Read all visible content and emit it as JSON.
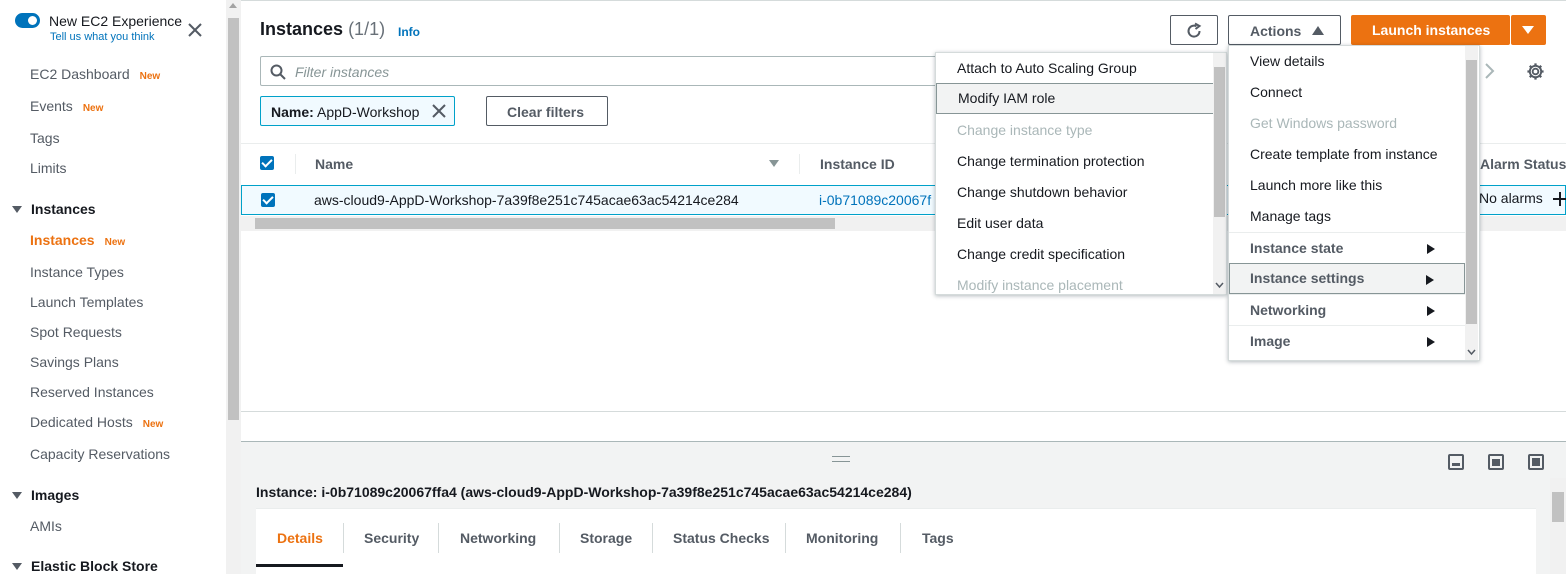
{
  "sidebar": {
    "experience_title": "New EC2 Experience",
    "experience_subtitle": "Tell us what you think",
    "items": [
      {
        "label": "EC2 Dashboard",
        "badge": "New"
      },
      {
        "label": "Events",
        "badge": "New"
      },
      {
        "label": "Tags"
      },
      {
        "label": "Limits"
      }
    ],
    "section_instances": "Instances",
    "instances_items": [
      {
        "label": "Instances",
        "badge": "New",
        "active": true
      },
      {
        "label": "Instance Types"
      },
      {
        "label": "Launch Templates"
      },
      {
        "label": "Spot Requests"
      },
      {
        "label": "Savings Plans"
      },
      {
        "label": "Reserved Instances"
      },
      {
        "label": "Dedicated Hosts",
        "badge": "New"
      },
      {
        "label": "Capacity Reservations"
      }
    ],
    "section_images": "Images",
    "images_items": [
      {
        "label": "AMIs"
      }
    ],
    "section_ebs": "Elastic Block Store"
  },
  "header": {
    "title": "Instances",
    "count": "(1/1)",
    "info": "Info",
    "actions_label": "Actions",
    "launch_label": "Launch instances"
  },
  "filter": {
    "placeholder": "Filter instances",
    "token_key": "Name:",
    "token_value": "AppD-Workshop",
    "clear_label": "Clear filters"
  },
  "table": {
    "columns": [
      "Name",
      "Instance ID",
      "Alarm Status"
    ],
    "rows": [
      {
        "name": "aws-cloud9-AppD-Workshop-7a39f8e251c745acae63ac54214ce284",
        "instance_id": "i-0b71089c20067f",
        "alarm_status": "No alarms"
      }
    ]
  },
  "actions_menu": {
    "items": [
      {
        "label": "View details"
      },
      {
        "label": "Connect"
      },
      {
        "label": "Get Windows password",
        "disabled": true
      },
      {
        "label": "Create template from instance"
      },
      {
        "label": "Launch more like this"
      },
      {
        "label": "Manage tags"
      },
      {
        "label": "Instance state",
        "submenu": true
      },
      {
        "label": "Instance settings",
        "submenu": true,
        "highlighted": true
      },
      {
        "label": "Networking",
        "submenu": true
      },
      {
        "label": "Image",
        "submenu": true
      }
    ]
  },
  "settings_menu": {
    "items": [
      {
        "label": "Attach to Auto Scaling Group"
      },
      {
        "label": "Modify IAM role",
        "highlighted": true
      },
      {
        "label": "Change instance type",
        "disabled": true
      },
      {
        "label": "Change termination protection"
      },
      {
        "label": "Change shutdown behavior"
      },
      {
        "label": "Edit user data"
      },
      {
        "label": "Change credit specification"
      },
      {
        "label": "Modify instance placement",
        "disabled": true
      }
    ]
  },
  "details": {
    "title": "Instance: i-0b71089c20067ffa4 (aws-cloud9-AppD-Workshop-7a39f8e251c745acae63ac54214ce284)",
    "tabs": [
      "Details",
      "Security",
      "Networking",
      "Storage",
      "Status Checks",
      "Monitoring",
      "Tags"
    ]
  },
  "colors": {
    "accent": "#ec7211",
    "link": "#0073bb",
    "selected_border": "#00a1c9"
  }
}
